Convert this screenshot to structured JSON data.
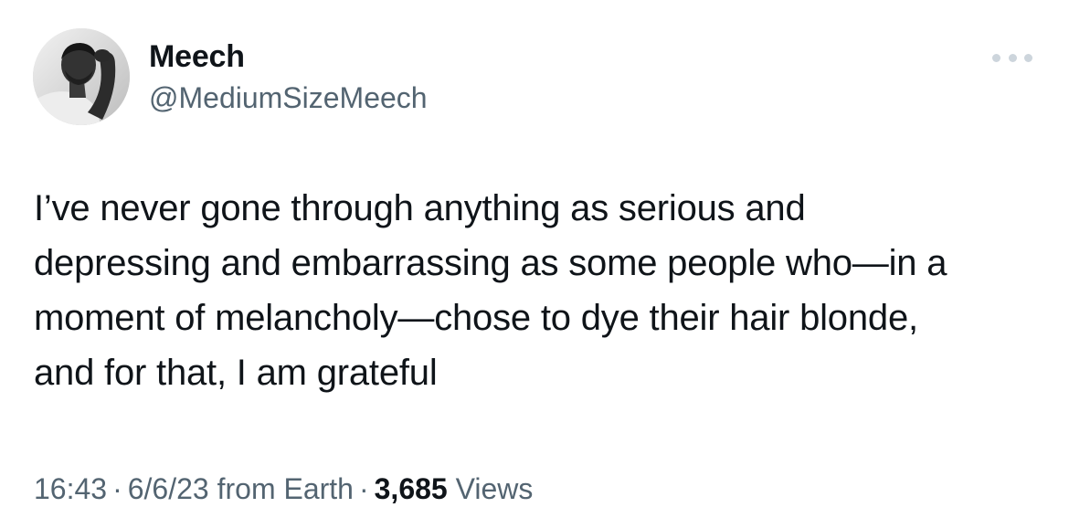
{
  "author": {
    "display_name": "Meech",
    "handle": "@MediumSizeMeech"
  },
  "more_icon": "more-horizontal-icon",
  "tweet": {
    "lines": [
      "I’ve never gone through anything as serious and",
      "depressing and embarrassing as some people who—in a",
      "moment of melancholy—chose to dye their hair blonde,",
      "and for that, I am grateful"
    ]
  },
  "meta": {
    "time": "16:43",
    "separator": "·",
    "date": "6/6/23",
    "source": "from Earth",
    "views_count": "3,685",
    "views_label": "Views"
  },
  "colors": {
    "text_primary": "#0f1419",
    "text_secondary": "#536471",
    "more_dots": "#cdd5dc"
  }
}
